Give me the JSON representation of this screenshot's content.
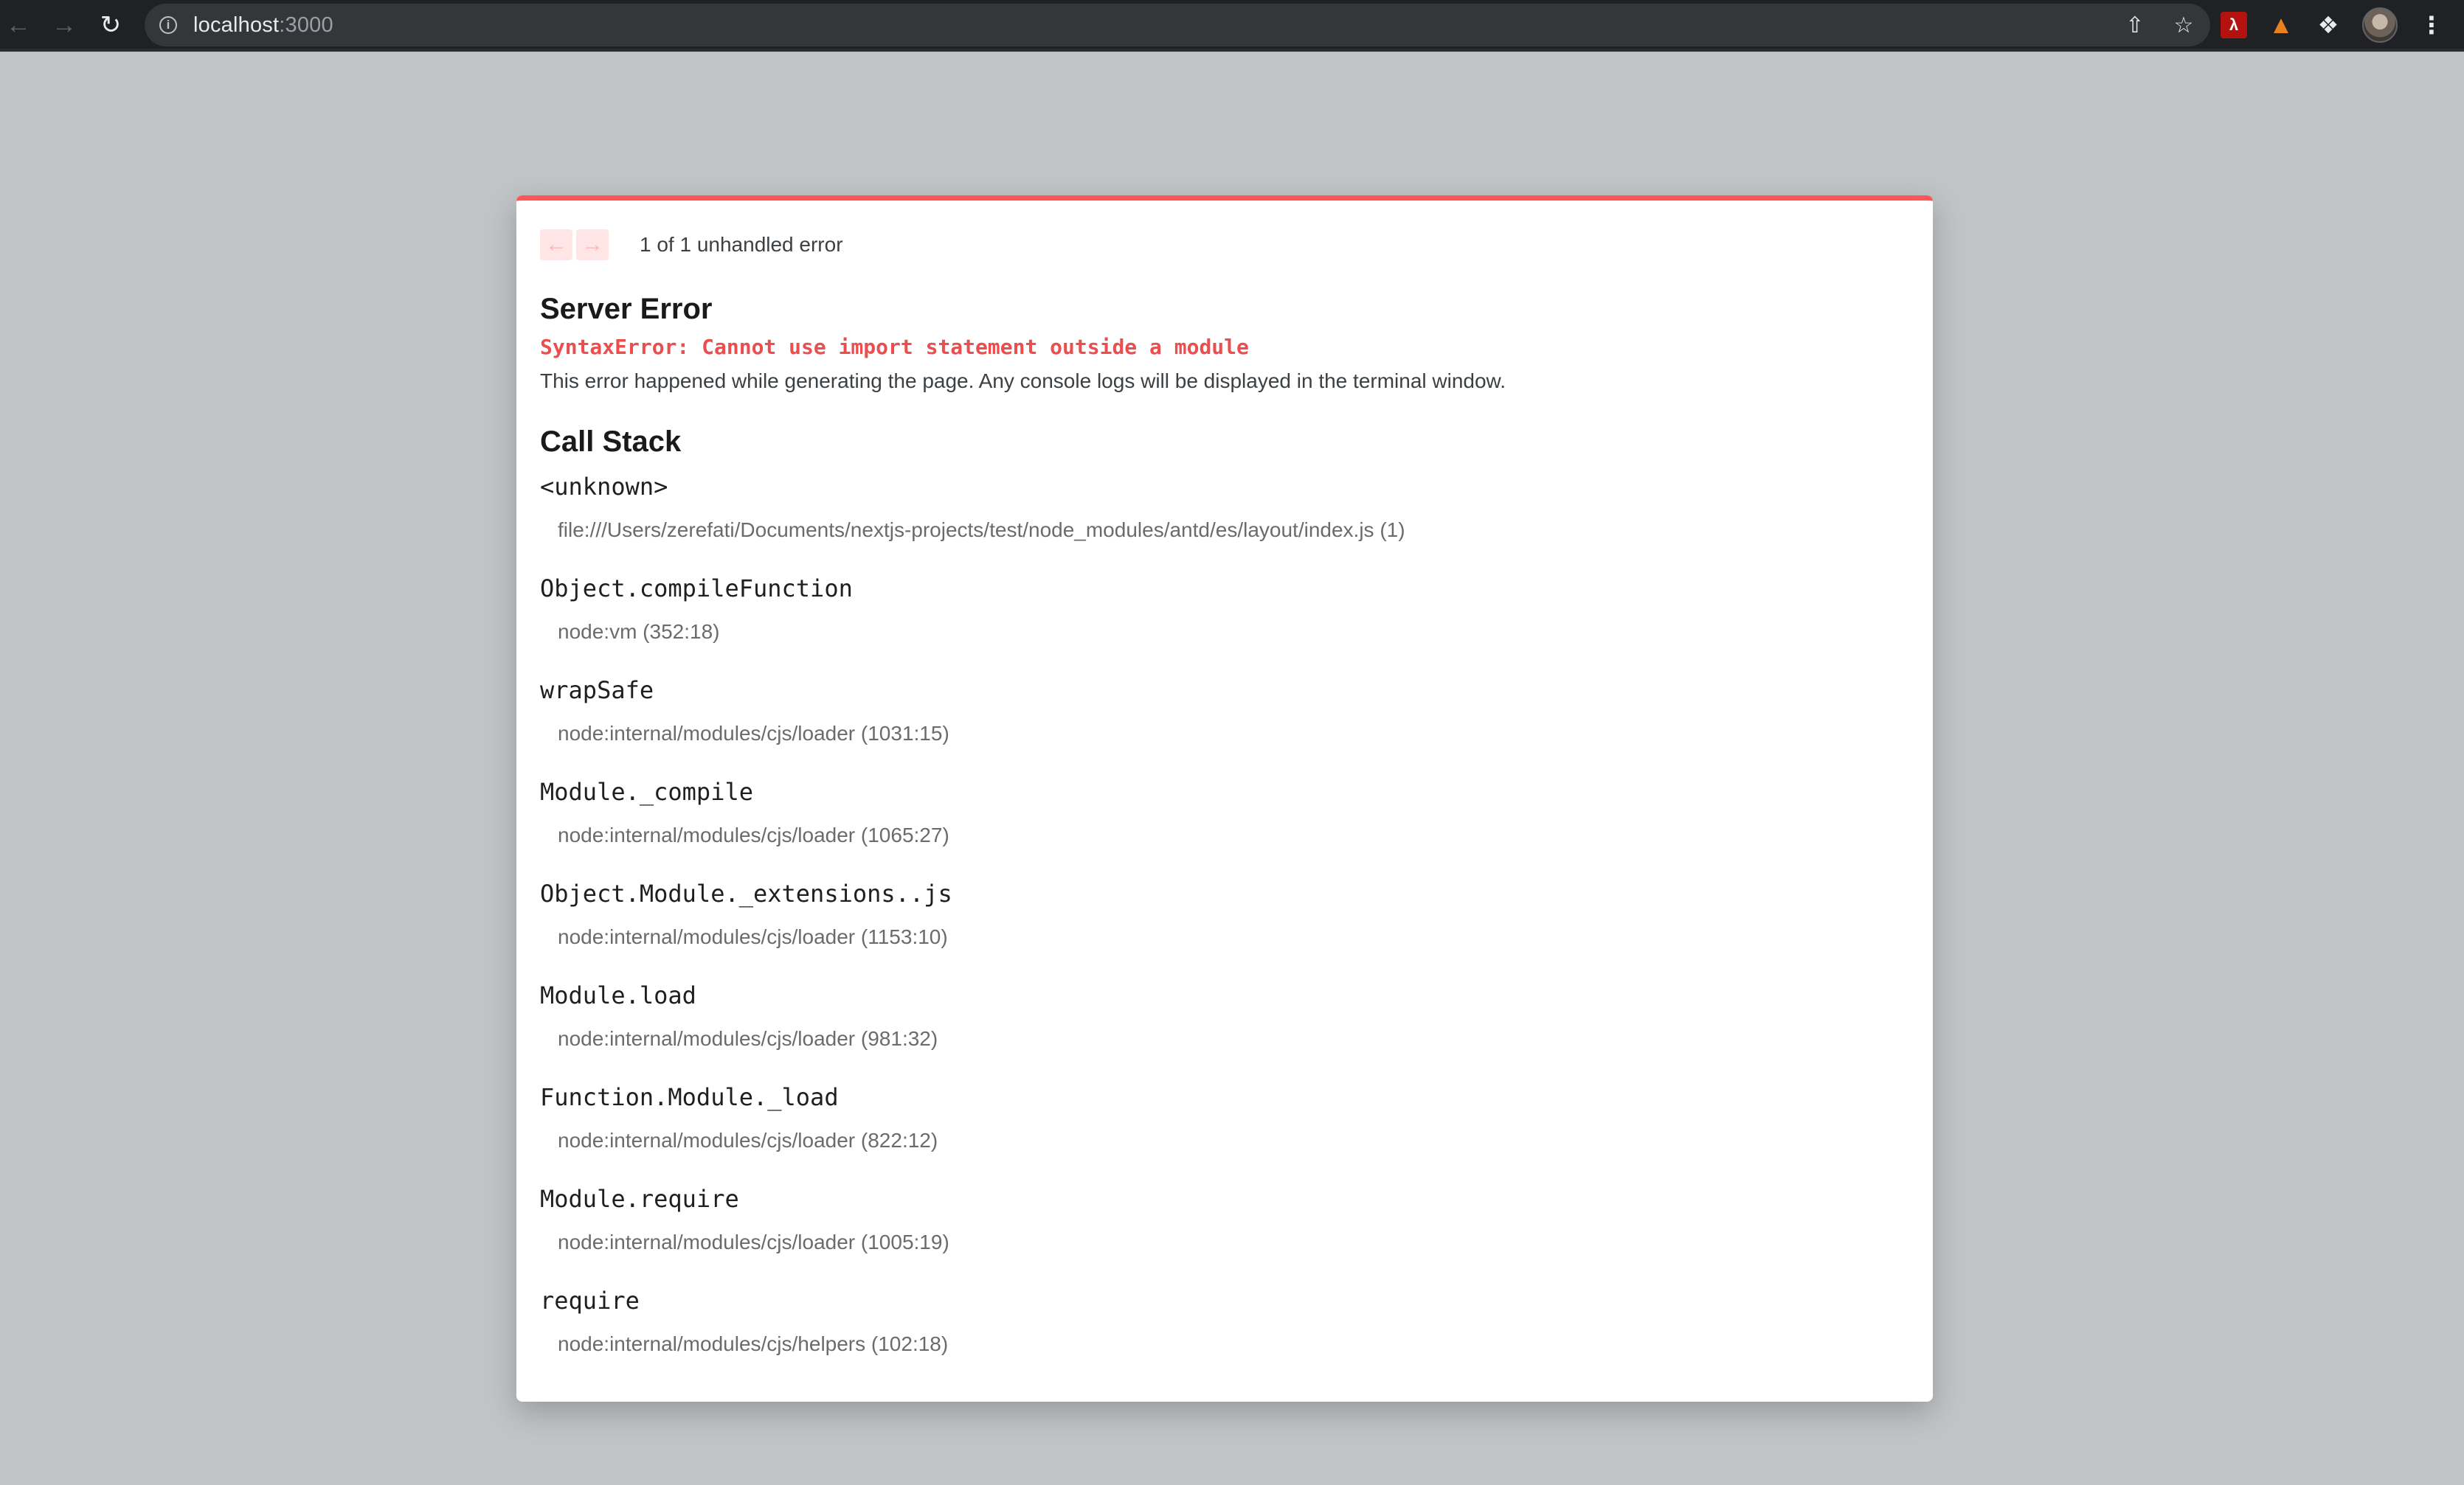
{
  "browser": {
    "url_host": "localhost",
    "url_port": ":3000"
  },
  "overlay": {
    "pager_text": "1 of 1 unhandled error",
    "title": "Server Error",
    "error_message": "SyntaxError: Cannot use import statement outside a module",
    "description": "This error happened while generating the page. Any console logs will be displayed in the terminal window.",
    "call_stack_title": "Call Stack",
    "frames": [
      {
        "fn": "<unknown>",
        "file": "file:///Users/zerefati/Documents/nextjs-projects/test/node_modules/antd/es/layout/index.js (1)"
      },
      {
        "fn": "Object.compileFunction",
        "file": "node:vm (352:18)"
      },
      {
        "fn": "wrapSafe",
        "file": "node:internal/modules/cjs/loader (1031:15)"
      },
      {
        "fn": "Module._compile",
        "file": "node:internal/modules/cjs/loader (1065:27)"
      },
      {
        "fn": "Object.Module._extensions..js",
        "file": "node:internal/modules/cjs/loader (1153:10)"
      },
      {
        "fn": "Module.load",
        "file": "node:internal/modules/cjs/loader (981:32)"
      },
      {
        "fn": "Function.Module._load",
        "file": "node:internal/modules/cjs/loader (822:12)"
      },
      {
        "fn": "Module.require",
        "file": "node:internal/modules/cjs/loader (1005:19)"
      },
      {
        "fn": "require",
        "file": "node:internal/modules/cjs/helpers (102:18)"
      }
    ]
  },
  "icons": {
    "back": "arrow-left-icon",
    "forward": "arrow-right-icon",
    "reload": "reload-icon",
    "info": "info-icon",
    "share": "share-icon",
    "bookmark": "star-icon",
    "extension_pdf": "acrobat-extension-icon",
    "extension_fox": "metamask-extension-icon",
    "extensions": "puzzle-icon",
    "profile": "avatar",
    "menu": "kebab-menu-icon"
  },
  "colors": {
    "accent_error": "#ff5555",
    "error_text": "#ea4e4e",
    "page_background": "#c1c4c7",
    "browser_chrome": "#202124"
  }
}
